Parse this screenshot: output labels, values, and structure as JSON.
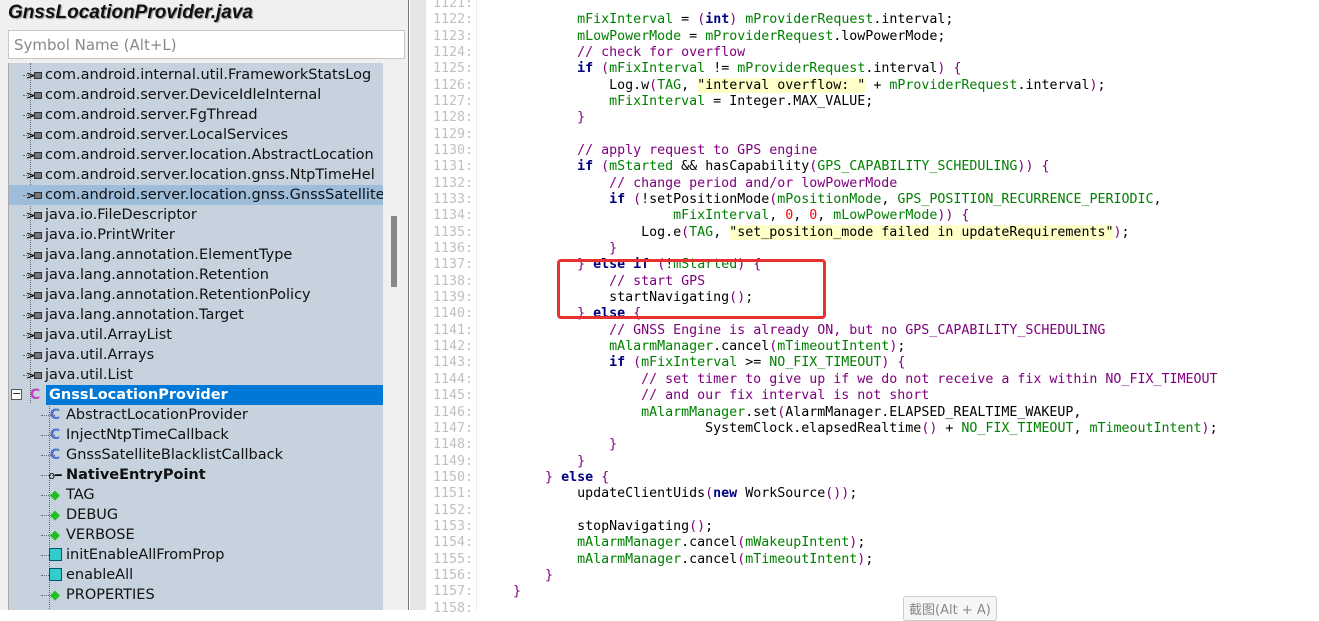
{
  "panel": {
    "title": "GnssLocationProvider.java",
    "search_placeholder": "Symbol Name (Alt+L)"
  },
  "tree": [
    {
      "label": "com.android.internal.util.FrameworkStatsLog",
      "icon": "import-icon"
    },
    {
      "label": "com.android.server.DeviceIdleInternal",
      "icon": "import-icon"
    },
    {
      "label": "com.android.server.FgThread",
      "icon": "import-icon"
    },
    {
      "label": "com.android.server.LocalServices",
      "icon": "import-icon"
    },
    {
      "label": "com.android.server.location.AbstractLocation",
      "icon": "import-icon"
    },
    {
      "label": "com.android.server.location.gnss.NtpTimeHel",
      "icon": "import-icon"
    },
    {
      "label": "com.android.server.location.gnss.GnssSatellite",
      "icon": "import-icon",
      "selected": true
    },
    {
      "label": "java.io.FileDescriptor",
      "icon": "import-icon"
    },
    {
      "label": "java.io.PrintWriter",
      "icon": "import-icon"
    },
    {
      "label": "java.lang.annotation.ElementType",
      "icon": "import-icon"
    },
    {
      "label": "java.lang.annotation.Retention",
      "icon": "import-icon"
    },
    {
      "label": "java.lang.annotation.RetentionPolicy",
      "icon": "import-icon"
    },
    {
      "label": "java.lang.annotation.Target",
      "icon": "import-icon"
    },
    {
      "label": "java.util.ArrayList",
      "icon": "import-icon"
    },
    {
      "label": "java.util.Arrays",
      "icon": "import-icon"
    },
    {
      "label": "java.util.List",
      "icon": "import-icon"
    },
    {
      "label": "GnssLocationProvider",
      "icon": "class-icon",
      "active": true
    },
    {
      "label": "AbstractLocationProvider",
      "icon": "class-icon",
      "child": true
    },
    {
      "label": "InjectNtpTimeCallback",
      "icon": "class-icon",
      "child": true
    },
    {
      "label": "GnssSatelliteBlacklistCallback",
      "icon": "class-icon",
      "child": true
    },
    {
      "label": "NativeEntryPoint",
      "icon": "annotation-icon",
      "child": true,
      "bold": true
    },
    {
      "label": "TAG",
      "icon": "field-icon",
      "child": true
    },
    {
      "label": "DEBUG",
      "icon": "field-icon",
      "child": true
    },
    {
      "label": "VERBOSE",
      "icon": "field-icon",
      "child": true
    },
    {
      "label": "initEnableAllFromProp",
      "icon": "method-icon",
      "child": true
    },
    {
      "label": "enableAll",
      "icon": "method-icon",
      "child": true
    },
    {
      "label": "PROPERTIES",
      "icon": "field-icon",
      "child": true
    }
  ],
  "code": {
    "first_line": 1121,
    "lines": [
      "",
      "            mFixInterval = (int) mProviderRequest.interval;",
      "            mLowPowerMode = mProviderRequest.lowPowerMode;",
      "            // check for overflow",
      "            if (mFixInterval != mProviderRequest.interval) {",
      "                Log.w(TAG, \"interval overflow: \" + mProviderRequest.interval);",
      "                mFixInterval = Integer.MAX_VALUE;",
      "            }",
      "",
      "            // apply request to GPS engine",
      "            if (mStarted && hasCapability(GPS_CAPABILITY_SCHEDULING)) {",
      "                // change period and/or lowPowerMode",
      "                if (!setPositionMode(mPositionMode, GPS_POSITION_RECURRENCE_PERIODIC,",
      "                        mFixInterval, 0, 0, mLowPowerMode)) {",
      "                    Log.e(TAG, \"set_position_mode failed in updateRequirements\");",
      "                }",
      "            } else if (!mStarted) {",
      "                // start GPS",
      "                startNavigating();",
      "            } else {",
      "                // GNSS Engine is already ON, but no GPS_CAPABILITY_SCHEDULING",
      "                mAlarmManager.cancel(mTimeoutIntent);",
      "                if (mFixInterval >= NO_FIX_TIMEOUT) {",
      "                    // set timer to give up if we do not receive a fix within NO_FIX_TIMEOUT",
      "                    // and our fix interval is not short",
      "                    mAlarmManager.set(AlarmManager.ELAPSED_REALTIME_WAKEUP,",
      "                            SystemClock.elapsedRealtime() + NO_FIX_TIMEOUT, mTimeoutIntent);",
      "                }",
      "            }",
      "        } else {",
      "            updateClientUids(new WorkSource());",
      "",
      "            stopNavigating();",
      "            mAlarmManager.cancel(mWakeupIntent);",
      "            mAlarmManager.cancel(mTimeoutIntent);",
      "        }",
      "    }",
      ""
    ]
  },
  "tooltip": "截图(Alt + A)",
  "colors": {
    "highlight_box": "#e8302f",
    "selection": "#0078d7",
    "comment": "#800080",
    "identifier": "#008000",
    "keyword": "#000080"
  }
}
